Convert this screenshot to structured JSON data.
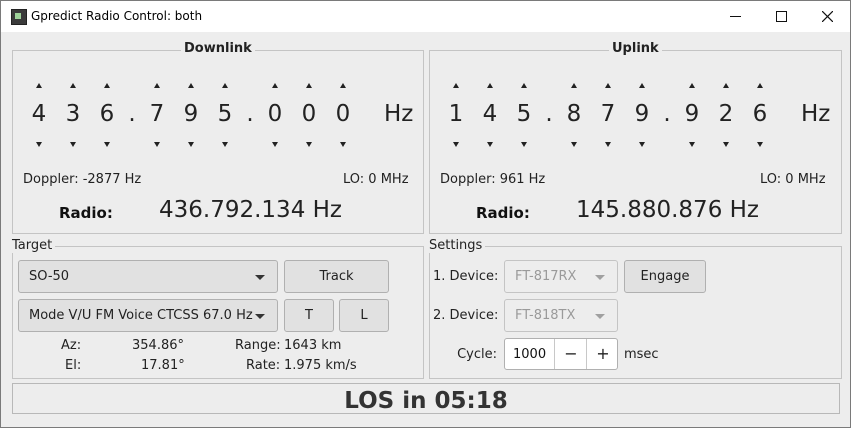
{
  "window": {
    "title": "Gpredict Radio Control: both",
    "minimize_icon": "minimize-icon",
    "maximize_icon": "maximize-icon",
    "close_icon": "close-icon"
  },
  "downlink": {
    "title": "Downlink",
    "digits": [
      "4",
      "3",
      "6",
      ".",
      "7",
      "9",
      "5",
      ".",
      "0",
      "0",
      "0"
    ],
    "unit": "Hz",
    "doppler": "Doppler: -2877 Hz",
    "lo": "LO:  0 MHz",
    "radio_label": "Radio:",
    "radio_freq": "436.792.134 Hz"
  },
  "uplink": {
    "title": "Uplink",
    "digits": [
      "1",
      "4",
      "5",
      ".",
      "8",
      "7",
      "9",
      ".",
      "9",
      "2",
      "6"
    ],
    "unit": "Hz",
    "doppler": "Doppler: 961 Hz",
    "lo": "LO:  0 MHz",
    "radio_label": "Radio:",
    "radio_freq": "145.880.876 Hz"
  },
  "target": {
    "title": "Target",
    "satellite": "SO-50",
    "transponder": "Mode V/U FM Voice CTCSS 67.0 Hz",
    "track_label": "Track",
    "t_label": "T",
    "l_label": "L",
    "az_label": "Az:",
    "az_value": "354.86°",
    "el_label": "El:",
    "el_value": "17.81°",
    "range_label": "Range:",
    "range_value": "1643 km",
    "rate_label": "Rate:",
    "rate_value": "1.975 km/s"
  },
  "settings": {
    "title": "Settings",
    "device1_label": "1. Device:",
    "device1_value": "FT-817RX",
    "device2_label": "2. Device:",
    "device2_value": "FT-818TX",
    "engage_label": "Engage",
    "cycle_label": "Cycle:",
    "cycle_value": "1000",
    "cycle_minus": "−",
    "cycle_plus": "+",
    "cycle_unit": "msec"
  },
  "status": {
    "text": "LOS in 05:18"
  }
}
